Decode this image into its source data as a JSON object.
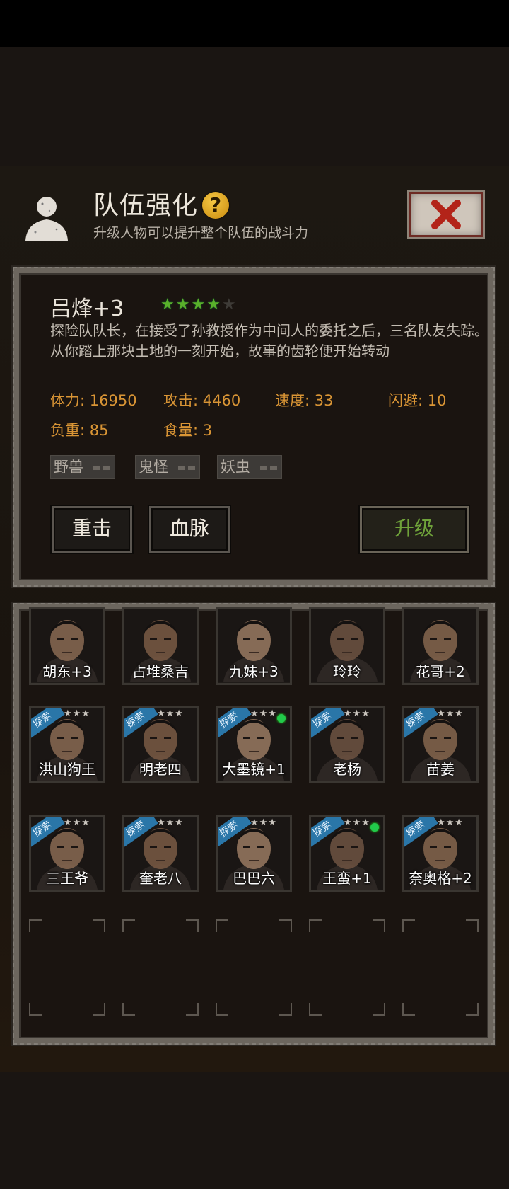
{
  "header": {
    "title": "队伍强化",
    "subtitle": "升级人物可以提升整个队伍的战斗力",
    "help_glyph": "?",
    "icons": {
      "avatar": "silhouette-icon",
      "help": "help-icon",
      "close": "close-x-icon"
    }
  },
  "selected": {
    "name": "吕烽+3",
    "stars_filled": 4,
    "stars_total": 5,
    "description": "探险队队长，在接受了孙教授作为中间人的委托之后，三名队友失踪。从你踏上那块土地的一刻开始，故事的齿轮便开始转动",
    "stats": {
      "hp": "体力: 16950",
      "attack": "攻击: 4460",
      "speed": "速度: 33",
      "dodge": "闪避: 10",
      "load": "负重: 85",
      "food": "食量: 3"
    },
    "tags": [
      "野兽",
      "鬼怪",
      "妖虫"
    ],
    "buttons": {
      "skill1": "重击",
      "skill2": "血脉",
      "upgrade": "升级"
    }
  },
  "roster": {
    "ribbon_label": "探索",
    "star_glyph": "★★★",
    "characters": [
      {
        "name": "胡东+3",
        "ribbon": false,
        "active": false
      },
      {
        "name": "占堆桑吉",
        "ribbon": false,
        "active": false
      },
      {
        "name": "九妹+3",
        "ribbon": false,
        "active": false
      },
      {
        "name": "玲玲",
        "ribbon": false,
        "active": false
      },
      {
        "name": "花哥+2",
        "ribbon": false,
        "active": false
      },
      {
        "name": "洪山狗王",
        "ribbon": true,
        "active": false
      },
      {
        "name": "明老四",
        "ribbon": true,
        "active": false
      },
      {
        "name": "大墨镜+1",
        "ribbon": true,
        "active": true
      },
      {
        "name": "老杨",
        "ribbon": true,
        "active": false
      },
      {
        "name": "苗姜",
        "ribbon": true,
        "active": false
      },
      {
        "name": "三王爷",
        "ribbon": true,
        "active": false
      },
      {
        "name": "奎老八",
        "ribbon": true,
        "active": false
      },
      {
        "name": "巴巴六",
        "ribbon": true,
        "active": false
      },
      {
        "name": "王蛮+1",
        "ribbon": true,
        "active": true
      },
      {
        "name": "奈奥格+2",
        "ribbon": true,
        "active": false
      }
    ],
    "empty_slots": 5
  },
  "colors": {
    "stat": "#d99535",
    "star_on": "#59b02b",
    "upgrade": "#6fa23a",
    "ribbon": "#2a76a8"
  }
}
